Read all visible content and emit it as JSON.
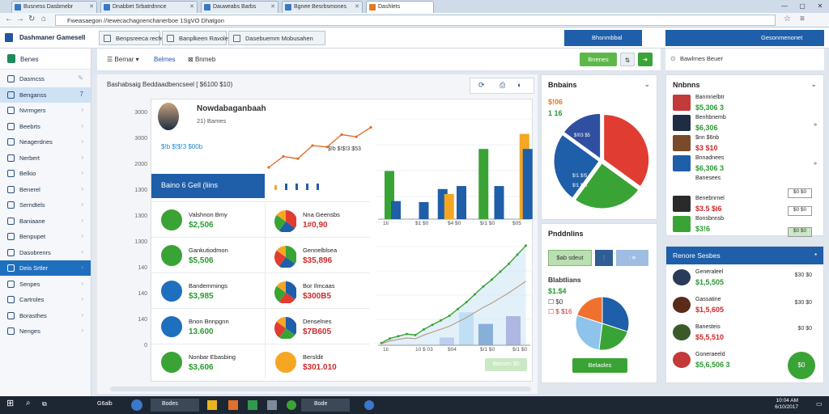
{
  "browser": {
    "tabs": [
      {
        "title": "Busness Dasbmebr"
      },
      {
        "title": "Dnabbet Srbatrdnnce"
      },
      {
        "title": "Dauweabs Barbs"
      },
      {
        "title": "Bgnee Besrbsmones"
      },
      {
        "title": "Dashlets"
      }
    ],
    "window_controls": [
      "—",
      "▢",
      "✕"
    ],
    "url": "Fweasaegon //Iewecachagnenchanerboe 1SgVO Dhatgon"
  },
  "app": {
    "title": "Dashmaner Gamesell",
    "header_tabs": [
      "Benpsreeca recfebgn",
      "Banplkeen Ravolep",
      "Dasebuemm Mobusahen"
    ],
    "header_right_items": [
      "Bhsnmbbal",
      "Gesonmenonet"
    ],
    "topbar_items": [
      "Bernar ▾",
      "Belmes",
      "Bnmeb"
    ],
    "topbar_button": "Bnenes",
    "topbar_right_text": "Bawlrnes Beuer"
  },
  "sidebar": {
    "title": "Benes",
    "items": [
      {
        "label": "Dasmcss",
        "icon": "grid-icon"
      },
      {
        "label": "Benganss",
        "icon": "chart-icon",
        "badge": "7"
      },
      {
        "label": "Nvrmgers",
        "icon": "user-icon"
      },
      {
        "label": "Beebrts",
        "icon": "report-icon"
      },
      {
        "label": "Neagerdnes",
        "icon": "settings-icon"
      },
      {
        "label": "Nerbert",
        "icon": "folder-icon"
      },
      {
        "label": "Belkio",
        "icon": "file-icon"
      },
      {
        "label": "Benerel",
        "icon": "calendar-icon"
      },
      {
        "label": "Serndtels",
        "icon": "message-icon"
      },
      {
        "label": "Baniaane",
        "icon": "box-icon"
      },
      {
        "label": "Benpupet",
        "icon": "cart-icon"
      },
      {
        "label": "Dasobrenrs",
        "icon": "dashboard-icon"
      },
      {
        "label": "Deis Srtler",
        "icon": "table-icon"
      },
      {
        "label": "Senpes",
        "icon": "tag-icon"
      },
      {
        "label": "Cartroles",
        "icon": "list-icon"
      },
      {
        "label": "Borasthes",
        "icon": "star-icon"
      },
      {
        "label": "Nenges",
        "icon": "tool-icon"
      }
    ]
  },
  "main": {
    "title": "Bashabsaig Beddaadbencseel [ $6100 $10)",
    "yaxis_labels": [
      "3000",
      "3000",
      "2000",
      "1300",
      "1300",
      "1300",
      "140",
      "140",
      "140",
      "0"
    ],
    "profile": {
      "name": "Nowdabaganbaah",
      "sub": "21) Bames"
    },
    "kpi_badge": "$!b $!$!3 $00b",
    "chart_caption": "$!b $!$!3 $53",
    "blue_banner": "Baino 6 Gell (liins",
    "stats_left": [
      {
        "label": "Valshnon Bmy",
        "value": "$2,506",
        "icon": "globe-icon"
      },
      {
        "label": "Gankutiodmon",
        "value": "$5,506",
        "icon": "handshake-icon"
      },
      {
        "label": "Bandemmings",
        "value": "$3,985",
        "icon": "laptop-icon"
      },
      {
        "label": "Bnon Bnnpgnn",
        "value": "13.600",
        "icon": "mouse-icon"
      },
      {
        "label": "Nonbar Ebasbing",
        "value": "$3,606",
        "icon": "globe-icon"
      }
    ],
    "stats_right": [
      {
        "label": "Nna Geensbs",
        "value": "1#0,90"
      },
      {
        "label": "Gennelblsea",
        "value": "$35,896"
      },
      {
        "label": "Bor Ilmcaas",
        "value": "$300B5"
      },
      {
        "label": "Denselnes",
        "value": "$7B605"
      },
      {
        "label": "Bersldit",
        "value": "$301.010"
      }
    ],
    "bar_axis": [
      "1ti",
      "$1 $0",
      "$4 $0",
      "$/1 $0",
      "$05"
    ],
    "line_axis": [
      "1ti",
      "10 $ 03",
      "$04",
      "$/1 $0",
      "$/1 $0"
    ],
    "bottom_button": "Basnes $0"
  },
  "panels": {
    "p1": {
      "title": "Bnbains",
      "value1": "$!06",
      "value2": "1 16",
      "pie_labels": [
        "$!03 $5",
        "$!1 $!5",
        "$!1 $!8"
      ]
    },
    "p2": {
      "title": "Pnddnlins",
      "btn_green": "$ab sdeut",
      "sub_title": "Blabtlians",
      "value1": "$1.$4",
      "value2": "$0",
      "value3": "$ $16",
      "bottom_button": "Belaoles"
    },
    "p3": {
      "title": "Nnbnns",
      "items": [
        {
          "name": "Banmnelbtr",
          "value": "$5,306 3",
          "color": "green"
        },
        {
          "name": "Benhbnemb",
          "value": "$6,306",
          "color": "green"
        },
        {
          "name": "$nn $6nb",
          "value": "$3 $10",
          "color": "red"
        },
        {
          "name": "Bnnadnees",
          "value": "$6,306 3",
          "color": "green"
        },
        {
          "name": "Banesees",
          "value": "",
          "color": "red"
        },
        {
          "name": "Benebnrnel",
          "value": "$3.5 $i6",
          "color": "red"
        },
        {
          "name": "Bonsbnnsb",
          "value": "$3!6",
          "color": "green"
        }
      ],
      "right_badges": [
        "$0 $0",
        "$0 $0",
        "$0 $0"
      ]
    },
    "p4": {
      "title": "Renore Sesbes",
      "items": [
        {
          "name": "Generaleel",
          "value": "$1,5,505",
          "color": "green"
        },
        {
          "name": "Gassatine",
          "value": "$1,5,605",
          "color": "red"
        },
        {
          "name": "Banesteis",
          "value": "$5,5,510",
          "color": "red"
        },
        {
          "name": "Goneraeeld",
          "value": "$5,6,506 3",
          "color": "green"
        }
      ],
      "right_values": [
        "$30 $0",
        "$30 $0",
        "$0 $0"
      ],
      "fab_label": "$0"
    }
  },
  "taskbar": {
    "search": "G6alb",
    "apps": [
      "Bodes",
      "Bode"
    ],
    "time": "10:04 AM",
    "date": "6/10/2017"
  },
  "colors": {
    "blue": "#1f6fbf",
    "green": "#3aa335",
    "orange": "#f5a623",
    "red": "#e03c31",
    "dark": "#1d2633"
  },
  "chart_data": [
    {
      "type": "line",
      "title": "",
      "x": [
        "1",
        "2",
        "3",
        "4",
        "5",
        "6",
        "7",
        "8"
      ],
      "series": [
        {
          "values": [
            40,
            55,
            52,
            70,
            68,
            85,
            82,
            95
          ]
        }
      ]
    },
    {
      "type": "bar",
      "title": "",
      "categories": [
        "1",
        "2",
        "3",
        "4",
        "5",
        "6",
        "7",
        "8"
      ],
      "series": [
        {
          "values": [
            0,
            0,
            17,
            30,
            33,
            0,
            33,
            0
          ]
        },
        {
          "values": [
            48,
            0,
            0,
            0,
            0,
            70,
            0,
            0
          ]
        },
        {
          "values": [
            0,
            0,
            0,
            25,
            0,
            0,
            0,
            85
          ]
        },
        {
          "values": [
            18,
            0,
            0,
            0,
            0,
            0,
            0,
            70
          ]
        }
      ]
    },
    {
      "type": "pie",
      "labels": [
        "Red",
        "Green",
        "Blue",
        "Navy"
      ],
      "values": [
        35,
        25,
        25,
        15
      ]
    }
  ]
}
